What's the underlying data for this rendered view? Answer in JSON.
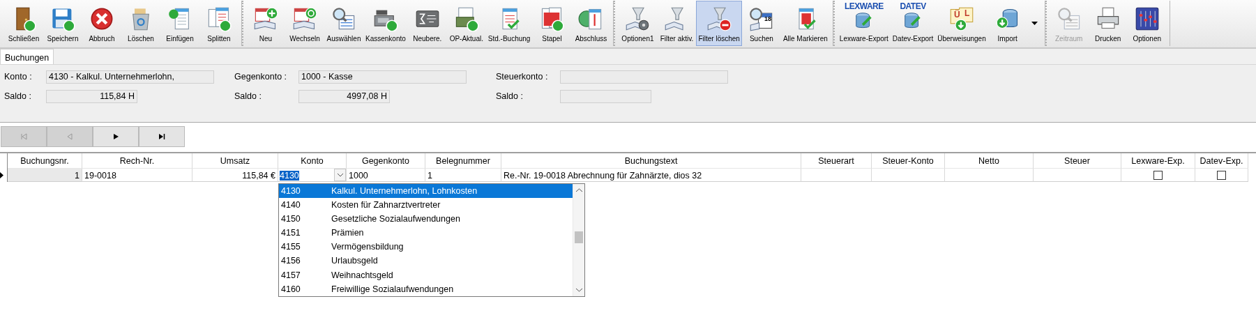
{
  "toolbar": {
    "groups": [
      {
        "items": [
          {
            "label": "Schließen",
            "selected": false,
            "disabled": false
          },
          {
            "label": "Speichern",
            "selected": false,
            "disabled": false
          },
          {
            "label": "Abbruch",
            "selected": false,
            "disabled": false
          },
          {
            "label": "Löschen",
            "selected": false,
            "disabled": false
          },
          {
            "label": "Einfügen",
            "selected": false,
            "disabled": false
          },
          {
            "label": "Splitten",
            "selected": false,
            "disabled": false
          }
        ]
      },
      {
        "items": [
          {
            "label": "Neu",
            "selected": false,
            "disabled": false
          },
          {
            "label": "Wechseln",
            "selected": false,
            "disabled": false
          },
          {
            "label": "Auswählen",
            "selected": false,
            "disabled": false
          },
          {
            "label": "Kassenkonto",
            "selected": false,
            "disabled": false
          },
          {
            "label": "Neubere.",
            "selected": false,
            "disabled": false
          },
          {
            "label": "OP-Aktual.",
            "selected": false,
            "disabled": false
          },
          {
            "label": "Std.-Buchung",
            "selected": false,
            "disabled": false
          },
          {
            "label": "Stapel",
            "selected": false,
            "disabled": false
          },
          {
            "label": "Abschluss",
            "selected": false,
            "disabled": false
          }
        ]
      },
      {
        "items": [
          {
            "label": "Optionen1",
            "selected": false,
            "disabled": false
          },
          {
            "label": "Filter aktiv.",
            "selected": false,
            "disabled": false
          },
          {
            "label": "Filter löschen",
            "selected": true,
            "disabled": false
          },
          {
            "label": "Suchen",
            "selected": false,
            "disabled": false,
            "icon_text": [
              "18"
            ]
          },
          {
            "label": "Alle Markieren",
            "selected": false,
            "disabled": false
          }
        ]
      },
      {
        "items": [
          {
            "label": "Lexware-Export",
            "selected": false,
            "disabled": false,
            "icon_text": [
              "LEXWARE"
            ]
          },
          {
            "label": "Datev-Export",
            "selected": false,
            "disabled": false,
            "icon_text": [
              "DATEV"
            ]
          },
          {
            "label": "Überweisungen",
            "selected": false,
            "disabled": false,
            "icon_text": [
              "Ü",
              "L"
            ]
          },
          {
            "label": "Import",
            "selected": false,
            "disabled": false
          }
        ],
        "overflow": true
      },
      {
        "items": [
          {
            "label": "Zeitraum",
            "selected": false,
            "disabled": true
          },
          {
            "label": "Drucken",
            "selected": false,
            "disabled": false
          },
          {
            "label": "Optionen",
            "selected": false,
            "disabled": false
          }
        ]
      }
    ]
  },
  "tabs": [
    {
      "label": "Buchungen",
      "selected": true
    }
  ],
  "form": {
    "columns": [
      {
        "fields": [
          {
            "label": "Konto :",
            "value": "4130 - Kalkul. Unternehmerlohn,",
            "kind": "text"
          },
          {
            "label": "Saldo :",
            "value": "115,84 H",
            "kind": "amount"
          }
        ]
      },
      {
        "fields": [
          {
            "label": "Gegenkonto :",
            "value": "1000 - Kasse",
            "kind": "text"
          },
          {
            "label": "Saldo :",
            "value": "4997,08 H",
            "kind": "amount"
          }
        ]
      },
      {
        "fields": [
          {
            "label": "Steuerkonto :",
            "kind": "text"
          },
          {
            "label": "Saldo :",
            "kind": "amount"
          }
        ]
      }
    ]
  },
  "navigator": [
    {
      "disabled": true
    },
    {
      "disabled": true
    },
    {
      "disabled": false
    },
    {
      "disabled": false
    }
  ],
  "grid": {
    "columns": [
      {
        "label": "Buchungsnr.",
        "kind": "key"
      },
      {
        "label": "Rech-Nr.",
        "kind": "text"
      },
      {
        "label": "Umsatz",
        "kind": "number"
      },
      {
        "label": "Konto",
        "kind": "combo"
      },
      {
        "label": "Gegenkonto",
        "kind": "text"
      },
      {
        "label": "Belegnummer",
        "kind": "text"
      },
      {
        "label": "Buchungstext",
        "kind": "text"
      },
      {
        "label": "Steuerart",
        "kind": "text"
      },
      {
        "label": "Steuer-Konto",
        "kind": "text"
      },
      {
        "label": "Netto",
        "kind": "number"
      },
      {
        "label": "Steuer",
        "kind": "number"
      },
      {
        "label": "Lexware-Exp.",
        "kind": "check"
      },
      {
        "label": "Datev-Exp.",
        "kind": "check"
      }
    ],
    "rows": [
      {
        "current": true,
        "cells": [
          {
            "value": "1"
          },
          {
            "value": "19-0018"
          },
          {
            "value": "115,84 €"
          },
          {
            "value": "4130"
          },
          {
            "value": "1000"
          },
          {
            "value": "1"
          },
          {
            "value": "Re.-Nr. 19-0018 Abrechnung für Zahnärzte, dios 32"
          },
          {},
          {},
          {},
          {},
          {
            "checked": false
          },
          {
            "checked": false
          }
        ]
      }
    ]
  },
  "dropdown": {
    "items": [
      {
        "code": "4130",
        "name": "Kalkul. Unternehmerlohn, Lohnkosten",
        "selected": true
      },
      {
        "code": "4140",
        "name": "Kosten für Zahnarztvertreter",
        "selected": false
      },
      {
        "code": "4150",
        "name": "Gesetzliche Sozialaufwendungen",
        "selected": false
      },
      {
        "code": "4151",
        "name": "Prämien",
        "selected": false
      },
      {
        "code": "4155",
        "name": "Vermögensbildung",
        "selected": false
      },
      {
        "code": "4156",
        "name": "Urlaubsgeld",
        "selected": false
      },
      {
        "code": "4157",
        "name": "Weihnachtsgeld",
        "selected": false
      },
      {
        "code": "4160",
        "name": "Freiwillige Sozialaufwendungen",
        "selected": false
      }
    ]
  }
}
